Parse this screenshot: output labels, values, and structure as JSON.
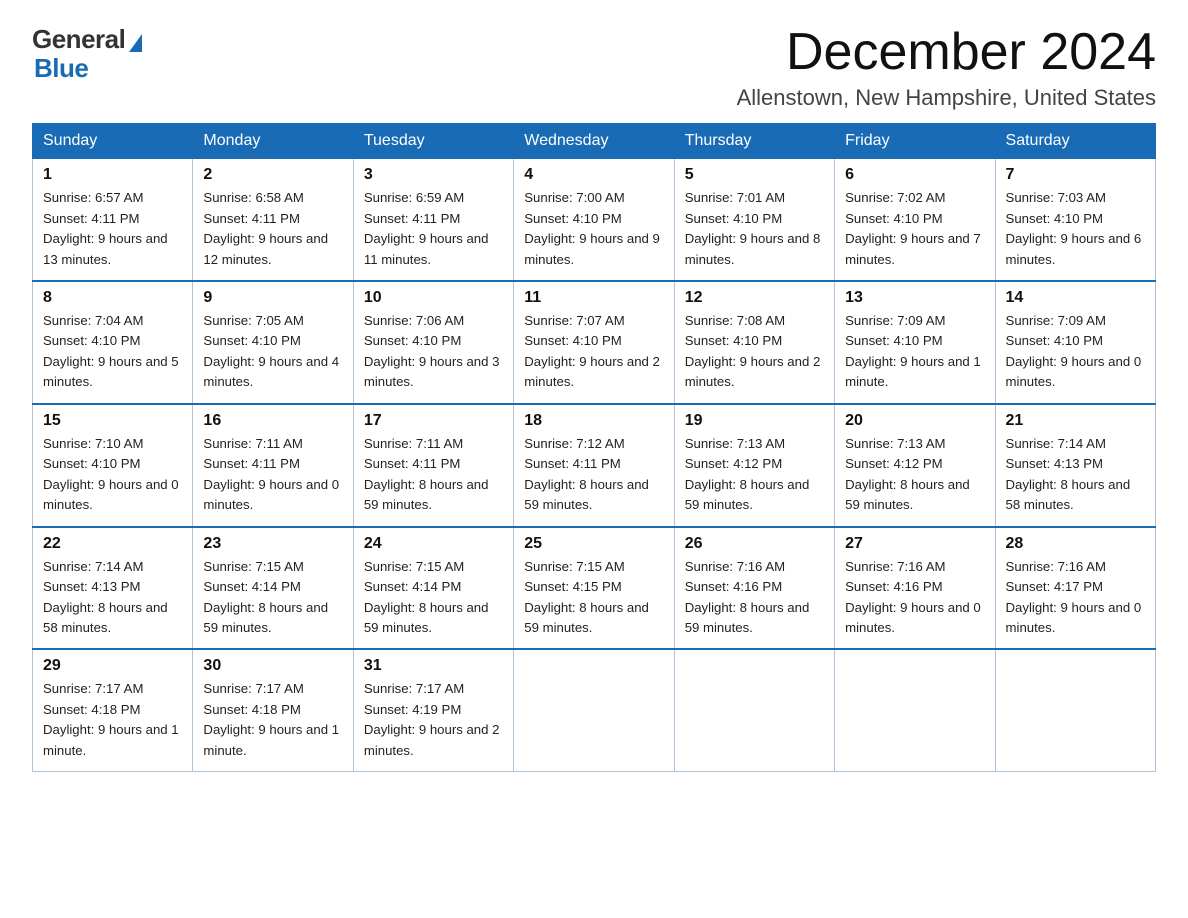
{
  "logo": {
    "general": "General",
    "blue": "Blue"
  },
  "title": "December 2024",
  "location": "Allenstown, New Hampshire, United States",
  "weekdays": [
    "Sunday",
    "Monday",
    "Tuesday",
    "Wednesday",
    "Thursday",
    "Friday",
    "Saturday"
  ],
  "weeks": [
    [
      {
        "day": "1",
        "sunrise": "6:57 AM",
        "sunset": "4:11 PM",
        "daylight": "9 hours and 13 minutes."
      },
      {
        "day": "2",
        "sunrise": "6:58 AM",
        "sunset": "4:11 PM",
        "daylight": "9 hours and 12 minutes."
      },
      {
        "day": "3",
        "sunrise": "6:59 AM",
        "sunset": "4:11 PM",
        "daylight": "9 hours and 11 minutes."
      },
      {
        "day": "4",
        "sunrise": "7:00 AM",
        "sunset": "4:10 PM",
        "daylight": "9 hours and 9 minutes."
      },
      {
        "day": "5",
        "sunrise": "7:01 AM",
        "sunset": "4:10 PM",
        "daylight": "9 hours and 8 minutes."
      },
      {
        "day": "6",
        "sunrise": "7:02 AM",
        "sunset": "4:10 PM",
        "daylight": "9 hours and 7 minutes."
      },
      {
        "day": "7",
        "sunrise": "7:03 AM",
        "sunset": "4:10 PM",
        "daylight": "9 hours and 6 minutes."
      }
    ],
    [
      {
        "day": "8",
        "sunrise": "7:04 AM",
        "sunset": "4:10 PM",
        "daylight": "9 hours and 5 minutes."
      },
      {
        "day": "9",
        "sunrise": "7:05 AM",
        "sunset": "4:10 PM",
        "daylight": "9 hours and 4 minutes."
      },
      {
        "day": "10",
        "sunrise": "7:06 AM",
        "sunset": "4:10 PM",
        "daylight": "9 hours and 3 minutes."
      },
      {
        "day": "11",
        "sunrise": "7:07 AM",
        "sunset": "4:10 PM",
        "daylight": "9 hours and 2 minutes."
      },
      {
        "day": "12",
        "sunrise": "7:08 AM",
        "sunset": "4:10 PM",
        "daylight": "9 hours and 2 minutes."
      },
      {
        "day": "13",
        "sunrise": "7:09 AM",
        "sunset": "4:10 PM",
        "daylight": "9 hours and 1 minute."
      },
      {
        "day": "14",
        "sunrise": "7:09 AM",
        "sunset": "4:10 PM",
        "daylight": "9 hours and 0 minutes."
      }
    ],
    [
      {
        "day": "15",
        "sunrise": "7:10 AM",
        "sunset": "4:10 PM",
        "daylight": "9 hours and 0 minutes."
      },
      {
        "day": "16",
        "sunrise": "7:11 AM",
        "sunset": "4:11 PM",
        "daylight": "9 hours and 0 minutes."
      },
      {
        "day": "17",
        "sunrise": "7:11 AM",
        "sunset": "4:11 PM",
        "daylight": "8 hours and 59 minutes."
      },
      {
        "day": "18",
        "sunrise": "7:12 AM",
        "sunset": "4:11 PM",
        "daylight": "8 hours and 59 minutes."
      },
      {
        "day": "19",
        "sunrise": "7:13 AM",
        "sunset": "4:12 PM",
        "daylight": "8 hours and 59 minutes."
      },
      {
        "day": "20",
        "sunrise": "7:13 AM",
        "sunset": "4:12 PM",
        "daylight": "8 hours and 59 minutes."
      },
      {
        "day": "21",
        "sunrise": "7:14 AM",
        "sunset": "4:13 PM",
        "daylight": "8 hours and 58 minutes."
      }
    ],
    [
      {
        "day": "22",
        "sunrise": "7:14 AM",
        "sunset": "4:13 PM",
        "daylight": "8 hours and 58 minutes."
      },
      {
        "day": "23",
        "sunrise": "7:15 AM",
        "sunset": "4:14 PM",
        "daylight": "8 hours and 59 minutes."
      },
      {
        "day": "24",
        "sunrise": "7:15 AM",
        "sunset": "4:14 PM",
        "daylight": "8 hours and 59 minutes."
      },
      {
        "day": "25",
        "sunrise": "7:15 AM",
        "sunset": "4:15 PM",
        "daylight": "8 hours and 59 minutes."
      },
      {
        "day": "26",
        "sunrise": "7:16 AM",
        "sunset": "4:16 PM",
        "daylight": "8 hours and 59 minutes."
      },
      {
        "day": "27",
        "sunrise": "7:16 AM",
        "sunset": "4:16 PM",
        "daylight": "9 hours and 0 minutes."
      },
      {
        "day": "28",
        "sunrise": "7:16 AM",
        "sunset": "4:17 PM",
        "daylight": "9 hours and 0 minutes."
      }
    ],
    [
      {
        "day": "29",
        "sunrise": "7:17 AM",
        "sunset": "4:18 PM",
        "daylight": "9 hours and 1 minute."
      },
      {
        "day": "30",
        "sunrise": "7:17 AM",
        "sunset": "4:18 PM",
        "daylight": "9 hours and 1 minute."
      },
      {
        "day": "31",
        "sunrise": "7:17 AM",
        "sunset": "4:19 PM",
        "daylight": "9 hours and 2 minutes."
      },
      null,
      null,
      null,
      null
    ]
  ]
}
